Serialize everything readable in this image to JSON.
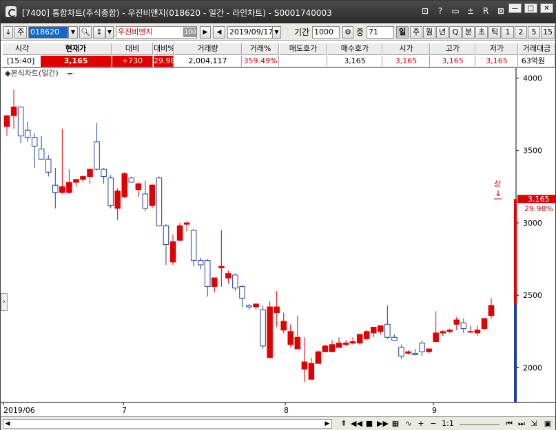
{
  "window": {
    "title": "[7400] 통합차트(주식종합) - 우진비앤지(018620 - 일간 - 라인차트) - S0001740003",
    "tools": [
      "⊡",
      "?",
      "▭",
      "±",
      "R",
      "⊠"
    ],
    "minimize": "—",
    "maximize": "□",
    "close": "✕"
  },
  "toolbar": {
    "nav_down": "↓",
    "market_type": "주",
    "code": "018620",
    "name": "우진비앤지",
    "badge": "100",
    "date": "2019/09/17",
    "period_label": "기간",
    "period": "1000",
    "count_label": "중",
    "count": "71",
    "intervals": [
      "일",
      "주",
      "월",
      "년",
      "Q",
      "분",
      "초",
      "틱",
      "1",
      "2",
      "5",
      "15"
    ]
  },
  "quote": {
    "headers": [
      "시각",
      "현재가",
      "대비",
      "대비%",
      "거래량",
      "거래%",
      "매도호가",
      "매수호가",
      "시가",
      "고가",
      "저가",
      "거래대금"
    ],
    "values": [
      "[15:40]",
      "3,165",
      "+730",
      "29.98%",
      "2,004,117",
      "359.49%",
      "",
      "3,165",
      "3,165",
      "3,165",
      "3,165",
      "63억원"
    ]
  },
  "chart": {
    "legend_label": "◆본식차트(일간)",
    "price_marker": "3,165",
    "price_pct": "29.98%",
    "limit_label": "상",
    "limit_arrow": "↓"
  },
  "chart_data": {
    "type": "candlestick",
    "y_ticks": [
      4000,
      3500,
      3000,
      2500,
      2000
    ],
    "ylim": [
      1760,
      4040
    ],
    "x_ticks": [
      "2019/06",
      "7",
      "8",
      "9"
    ],
    "candles": [
      {
        "o": 3665,
        "h": 3700,
        "l": 3600,
        "c": 3740
      },
      {
        "o": 3740,
        "h": 3920,
        "l": 3650,
        "c": 3800
      },
      {
        "o": 3800,
        "h": 3805,
        "l": 3550,
        "c": 3600
      },
      {
        "o": 3640,
        "h": 3700,
        "l": 3560,
        "c": 3590
      },
      {
        "o": 3590,
        "h": 3620,
        "l": 3380,
        "c": 3530
      },
      {
        "o": 3510,
        "h": 3600,
        "l": 3450,
        "c": 3440
      },
      {
        "o": 3440,
        "h": 3470,
        "l": 3320,
        "c": 3350
      },
      {
        "o": 3260,
        "h": 3380,
        "l": 3100,
        "c": 3210
      },
      {
        "o": 3210,
        "h": 3650,
        "l": 3200,
        "c": 3250
      },
      {
        "o": 3210,
        "h": 3370,
        "l": 3200,
        "c": 3280
      },
      {
        "o": 3280,
        "h": 3290,
        "l": 3250,
        "c": 3300
      },
      {
        "o": 3300,
        "h": 3330,
        "l": 3280,
        "c": 3320
      },
      {
        "o": 3320,
        "h": 3350,
        "l": 3270,
        "c": 3370
      },
      {
        "o": 3560,
        "h": 3690,
        "l": 3360,
        "c": 3370
      },
      {
        "o": 3370,
        "h": 3380,
        "l": 3270,
        "c": 3320
      },
      {
        "o": 3310,
        "h": 3330,
        "l": 3100,
        "c": 3120
      },
      {
        "o": 3100,
        "h": 3240,
        "l": 3020,
        "c": 3220
      },
      {
        "o": 3180,
        "h": 3350,
        "l": 3170,
        "c": 3340
      },
      {
        "o": 3310,
        "h": 3320,
        "l": 3290,
        "c": 3280
      },
      {
        "o": 3230,
        "h": 3280,
        "l": 3180,
        "c": 3270
      },
      {
        "o": 3200,
        "h": 3290,
        "l": 3080,
        "c": 3100
      },
      {
        "o": 3120,
        "h": 3270,
        "l": 3100,
        "c": 3260
      },
      {
        "o": 3310,
        "h": 3320,
        "l": 2990,
        "c": 2980
      },
      {
        "o": 2980,
        "h": 2990,
        "l": 2710,
        "c": 2850
      },
      {
        "o": 2730,
        "h": 2920,
        "l": 2710,
        "c": 2870
      },
      {
        "o": 2880,
        "h": 3000,
        "l": 2870,
        "c": 2980
      },
      {
        "o": 2990,
        "h": 3010,
        "l": 2940,
        "c": 3000
      },
      {
        "o": 2950,
        "h": 2960,
        "l": 2700,
        "c": 2740
      },
      {
        "o": 2740,
        "h": 2760,
        "l": 2680,
        "c": 2710
      },
      {
        "o": 2740,
        "h": 2750,
        "l": 2490,
        "c": 2560
      },
      {
        "o": 2560,
        "h": 2620,
        "l": 2520,
        "c": 2620
      },
      {
        "o": 2690,
        "h": 2950,
        "l": 2560,
        "c": 2700
      },
      {
        "o": 2620,
        "h": 2670,
        "l": 2580,
        "c": 2650
      },
      {
        "o": 2640,
        "h": 2650,
        "l": 2530,
        "c": 2550
      },
      {
        "o": 2560,
        "h": 2570,
        "l": 2420,
        "c": 2480
      },
      {
        "o": 2430,
        "h": 2440,
        "l": 2400,
        "c": 2420
      },
      {
        "o": 2420,
        "h": 2440,
        "l": 2400,
        "c": 2440
      },
      {
        "o": 2400,
        "h": 2430,
        "l": 2130,
        "c": 2150
      },
      {
        "o": 2070,
        "h": 2460,
        "l": 2070,
        "c": 2420
      },
      {
        "o": 2380,
        "h": 2530,
        "l": 2280,
        "c": 2420
      },
      {
        "o": 2260,
        "h": 2380,
        "l": 2240,
        "c": 2320
      },
      {
        "o": 2160,
        "h": 2300,
        "l": 2140,
        "c": 2250
      },
      {
        "o": 2130,
        "h": 2360,
        "l": 2140,
        "c": 2210
      },
      {
        "o": 1990,
        "h": 2210,
        "l": 1900,
        "c": 2040
      },
      {
        "o": 1920,
        "h": 2070,
        "l": 1920,
        "c": 2030
      },
      {
        "o": 2030,
        "h": 2120,
        "l": 2030,
        "c": 2110
      },
      {
        "o": 2110,
        "h": 2160,
        "l": 2110,
        "c": 2150
      },
      {
        "o": 2110,
        "h": 2190,
        "l": 2110,
        "c": 2160
      },
      {
        "o": 2140,
        "h": 2210,
        "l": 2140,
        "c": 2170
      },
      {
        "o": 2160,
        "h": 2190,
        "l": 2150,
        "c": 2170
      },
      {
        "o": 2170,
        "h": 2210,
        "l": 2160,
        "c": 2180
      },
      {
        "o": 2170,
        "h": 2230,
        "l": 2160,
        "c": 2230
      },
      {
        "o": 2200,
        "h": 2260,
        "l": 2190,
        "c": 2250
      },
      {
        "o": 2240,
        "h": 2280,
        "l": 2210,
        "c": 2280
      },
      {
        "o": 2250,
        "h": 2290,
        "l": 2230,
        "c": 2290
      },
      {
        "o": 2300,
        "h": 2430,
        "l": 2200,
        "c": 2210
      },
      {
        "o": 2210,
        "h": 2230,
        "l": 2190,
        "c": 2190
      },
      {
        "o": 2140,
        "h": 2160,
        "l": 2060,
        "c": 2080
      },
      {
        "o": 2100,
        "h": 2120,
        "l": 2090,
        "c": 2110
      },
      {
        "o": 2100,
        "h": 2130,
        "l": 2090,
        "c": 2090
      },
      {
        "o": 2170,
        "h": 2190,
        "l": 2080,
        "c": 2110
      },
      {
        "o": 2110,
        "h": 2130,
        "l": 2100,
        "c": 2130
      },
      {
        "o": 2180,
        "h": 2390,
        "l": 2180,
        "c": 2240
      },
      {
        "o": 2240,
        "h": 2260,
        "l": 2220,
        "c": 2250
      },
      {
        "o": 2250,
        "h": 2270,
        "l": 2240,
        "c": 2260
      },
      {
        "o": 2300,
        "h": 2350,
        "l": 2260,
        "c": 2330
      },
      {
        "o": 2310,
        "h": 2340,
        "l": 2240,
        "c": 2270
      },
      {
        "o": 2250,
        "h": 2290,
        "l": 2240,
        "c": 2250
      },
      {
        "o": 2240,
        "h": 2290,
        "l": 2220,
        "c": 2260
      },
      {
        "o": 2270,
        "h": 2340,
        "l": 2260,
        "c": 2340
      },
      {
        "o": 2360,
        "h": 2480,
        "l": 2340,
        "c": 2430
      }
    ],
    "volume_bar": {
      "red_from": 3165,
      "blue_to": 2440,
      "colors": {
        "up": "#e00000",
        "down": "#1f3fa0"
      }
    }
  }
}
